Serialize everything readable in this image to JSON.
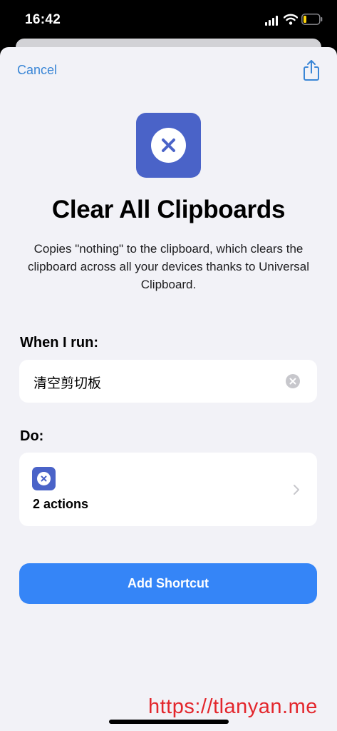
{
  "status_bar": {
    "time": "16:42",
    "icons": [
      "cellular-signal-icon",
      "wifi-icon",
      "battery-low-icon"
    ]
  },
  "nav": {
    "cancel_label": "Cancel",
    "share_icon": "share-icon"
  },
  "shortcut": {
    "icon": "x-circle-icon",
    "icon_color": "#4a63c8",
    "title": "Clear All Clipboards",
    "description": "Copies \"nothing\" to the clipboard, which clears the clipboard across all your devices thanks to Universal Clipboard."
  },
  "when_section": {
    "label": "When I run:",
    "phrase_value": "清空剪切板",
    "clear_icon": "clear-circle-icon"
  },
  "do_section": {
    "label": "Do:",
    "actions_text": "2 actions",
    "chevron_icon": "chevron-right-icon"
  },
  "add_button_label": "Add Shortcut",
  "accent_color": "#3585f7",
  "watermark": "https://tlanyan.me"
}
